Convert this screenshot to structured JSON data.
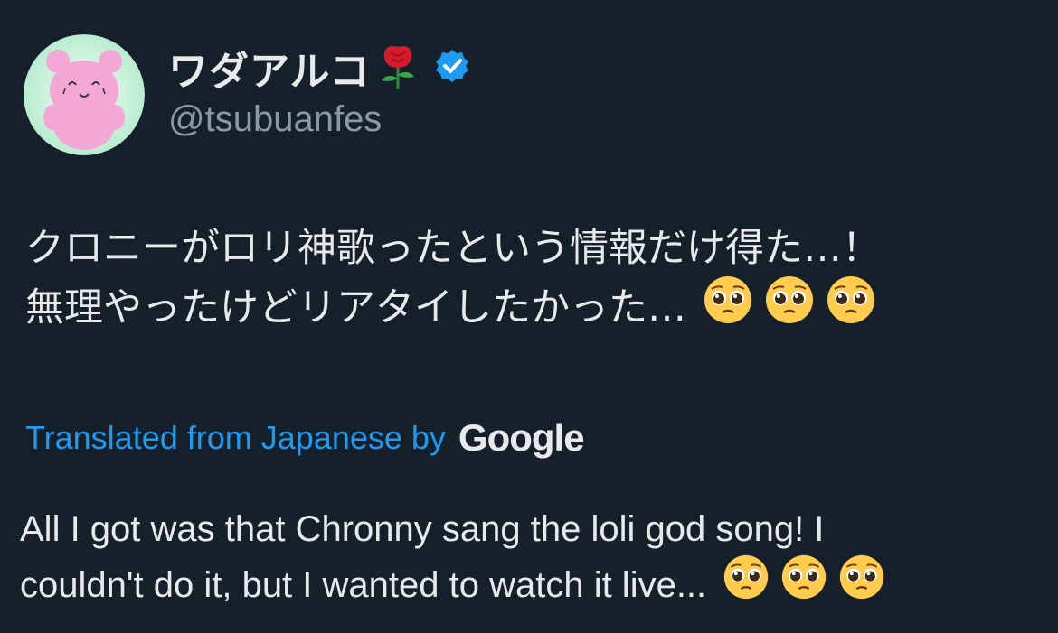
{
  "author": {
    "display_name": "ワダアルコ",
    "handle": "@tsubuanfes",
    "name_emoji_icon": "rose-icon",
    "verified_icon": "verified-badge-icon",
    "avatar_icon": "pink-bear-avatar"
  },
  "tweet": {
    "japanese_line_1": "クロニーがロリ神歌ったという情報だけ得た…！",
    "japanese_line_2": "無理やったけどリアタイしたかった…",
    "translated_label": "Translated from Japanese by",
    "translator_brand": "Google",
    "english_line_1": "All I got was that Chronny sang the loli god song! I",
    "english_line_2": "couldn't do it, but I wanted to watch it live...",
    "trailing_emoji_icon": "pleading-face-icon",
    "trailing_emoji_count": 3
  },
  "colors": {
    "background": "#15202b",
    "text": "#e7e9ea",
    "handle": "#8b98a5",
    "accent": "#1d9bf0"
  }
}
